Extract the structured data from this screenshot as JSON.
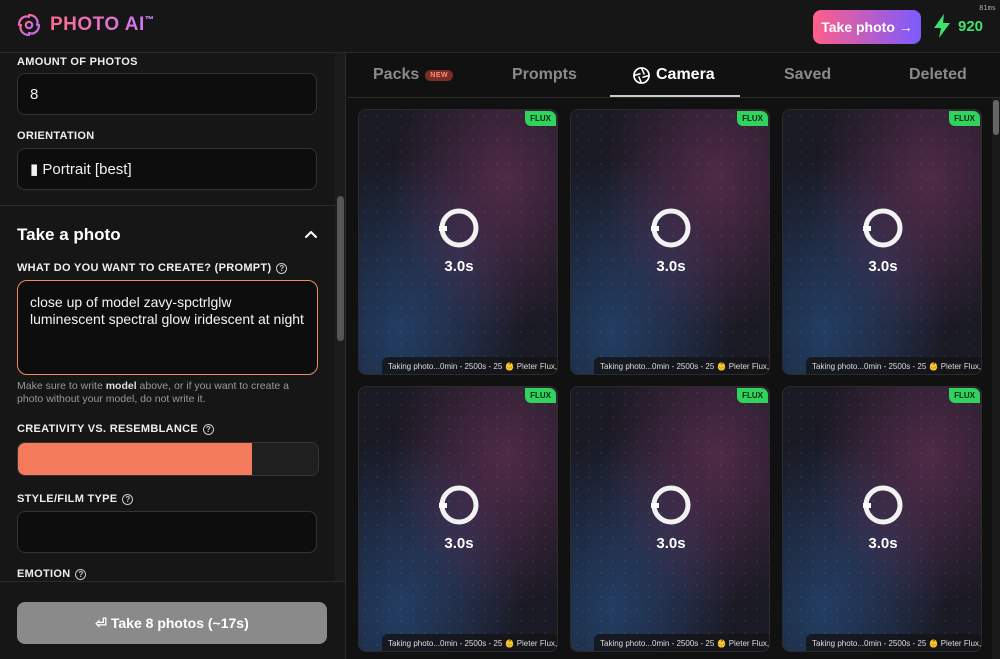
{
  "header": {
    "logo_text": "PHOTO AI",
    "logo_tm": "™",
    "timing": "81ms",
    "take_photo_label": "Take photo →",
    "credits": "920"
  },
  "sidebar": {
    "amount_label": "AMOUNT OF PHOTOS",
    "amount_value": "8",
    "orientation_label": "ORIENTATION",
    "orientation_value": "▮ Portrait [best]",
    "section_title": "Take a photo",
    "prompt_label": "WHAT DO YOU WANT TO CREATE? (PROMPT)",
    "prompt_value": "close up of model zavy-spctrlglw luminescent spectral glow iridescent at night",
    "hint_pre": "Make sure to write ",
    "hint_bold": "model",
    "hint_post": " above, or if you want to create a photo without your model, do not write it.",
    "creativity_label": "CREATIVITY VS. RESEMBLANCE",
    "creativity_value": 0.78,
    "style_label": "STYLE/FILM TYPE",
    "style_value": "",
    "emotion_label": "EMOTION",
    "cta_label": "⏎ Take 8 photos (~17s)"
  },
  "tabs": [
    {
      "label": "Packs",
      "badge": "NEW"
    },
    {
      "label": "Prompts"
    },
    {
      "label": "Camera",
      "active": true
    },
    {
      "label": "Saved"
    },
    {
      "label": "Deleted"
    }
  ],
  "cards": [
    {
      "badge": "FLUX",
      "time": "3.0s",
      "caption": "Taking photo...0min - 2500s - 25 👶 Pieter Flux,"
    },
    {
      "badge": "FLUX",
      "time": "3.0s",
      "caption": "Taking photo...0min - 2500s - 25 👶 Pieter Flux,"
    },
    {
      "badge": "FLUX",
      "time": "3.0s",
      "caption": "Taking photo...0min - 2500s - 25 👶 Pieter Flux,"
    },
    {
      "badge": "FLUX",
      "time": "3.0s",
      "caption": "Taking photo...0min - 2500s - 25 👶 Pieter Flux,"
    },
    {
      "badge": "FLUX",
      "time": "3.0s",
      "caption": "Taking photo...0min - 2500s - 25 👶 Pieter Flux,"
    },
    {
      "badge": "FLUX",
      "time": "3.0s",
      "caption": "Taking photo...0min - 2500s - 25 👶 Pieter Flux,"
    }
  ],
  "colors": {
    "accent": "#f47a5c",
    "credits": "#3ee36e",
    "flux_badge": "#2fd35d"
  }
}
